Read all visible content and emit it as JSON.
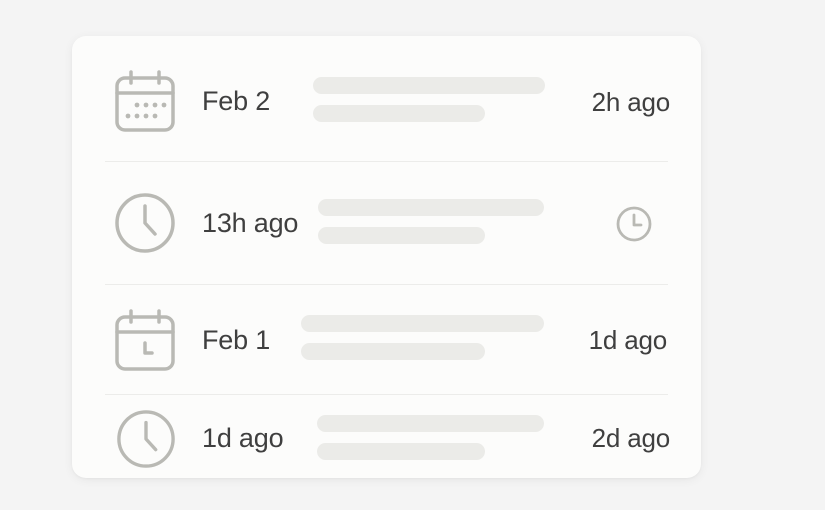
{
  "activity_feed": {
    "items": [
      {
        "icon": "calendar-icon",
        "label": "Feb 2",
        "time": "2h ago"
      },
      {
        "icon": "clock-icon",
        "label": "13h ago",
        "time": "",
        "trailing_icon": "clock-icon"
      },
      {
        "icon": "calendar-icon",
        "label": "Feb 1",
        "time": "1d ago"
      },
      {
        "icon": "clock-icon",
        "label": "1d ago",
        "time": "2d ago"
      }
    ]
  },
  "colors": {
    "icon": "#b9b9b4",
    "text": "#3f3f3f",
    "placeholder_bar": "#ebebe8",
    "card": "#fcfcfb",
    "background": "#f4f4f4"
  }
}
